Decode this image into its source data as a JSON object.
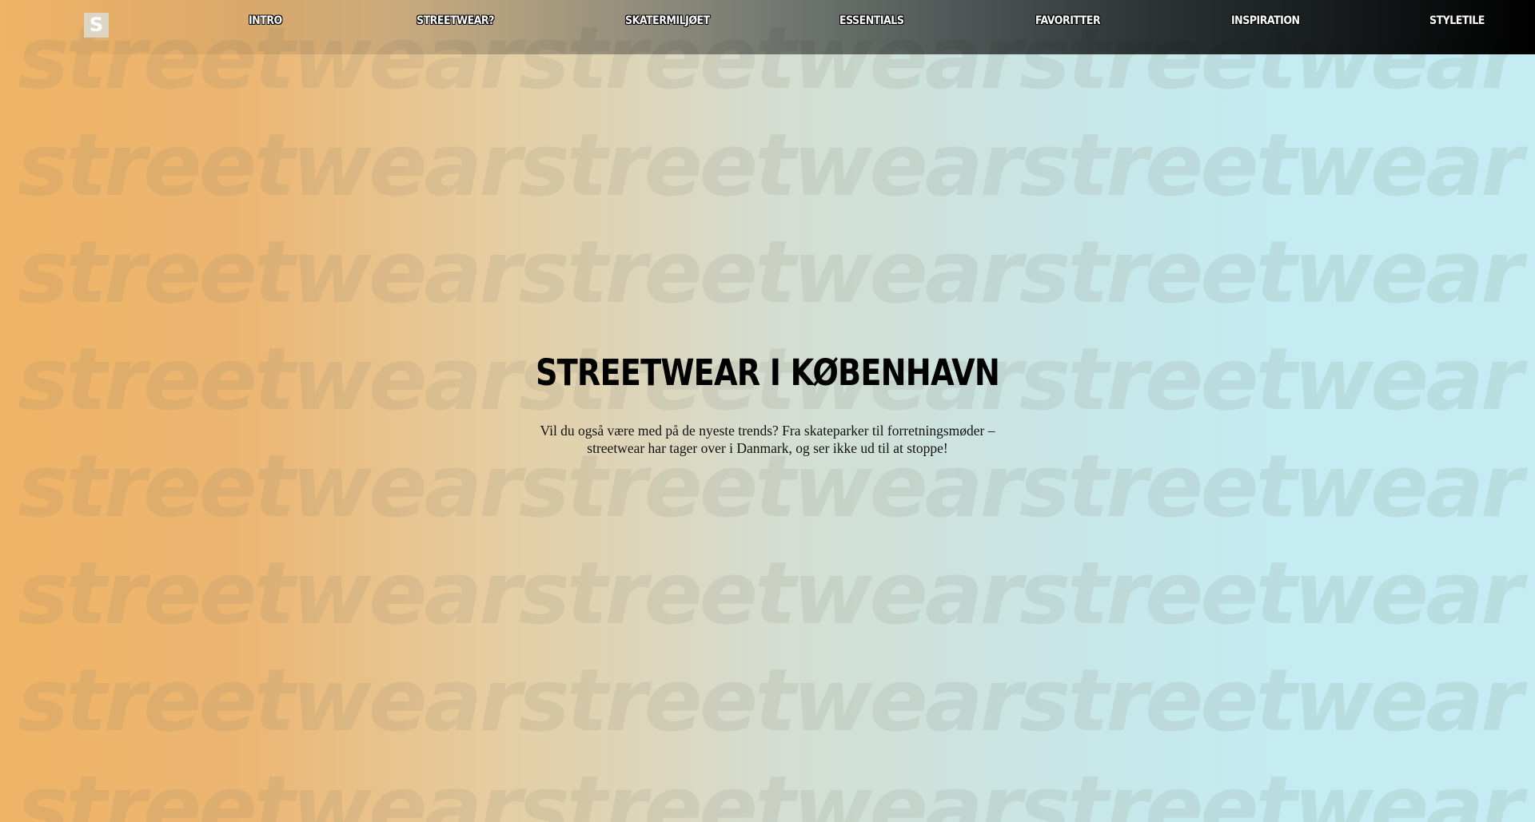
{
  "nav": {
    "logo_letter": "S",
    "links": [
      {
        "label": "INTRO"
      },
      {
        "label": "STREETWEAR?"
      },
      {
        "label": "SKATERMILJØET"
      },
      {
        "label": "ESSENTIALS"
      },
      {
        "label": "FAVORITTER"
      },
      {
        "label": "INSPIRATION"
      },
      {
        "label": "STYLETILE"
      }
    ]
  },
  "background": {
    "watermark_text": "streetwearstreetwearstreetwear"
  },
  "hero": {
    "title": "STREETWEAR I KØBENHAVN",
    "text": "Vil du også være med på de nyeste trends? Fra skateparker til forretningsmøder – streetwear har tager over i Danmark, og ser ikke ud til at stoppe!"
  },
  "colors": {
    "gradient_start": "#efb466",
    "gradient_end": "#c4ecf2",
    "nav_end": "#000000",
    "title": "#000000"
  }
}
